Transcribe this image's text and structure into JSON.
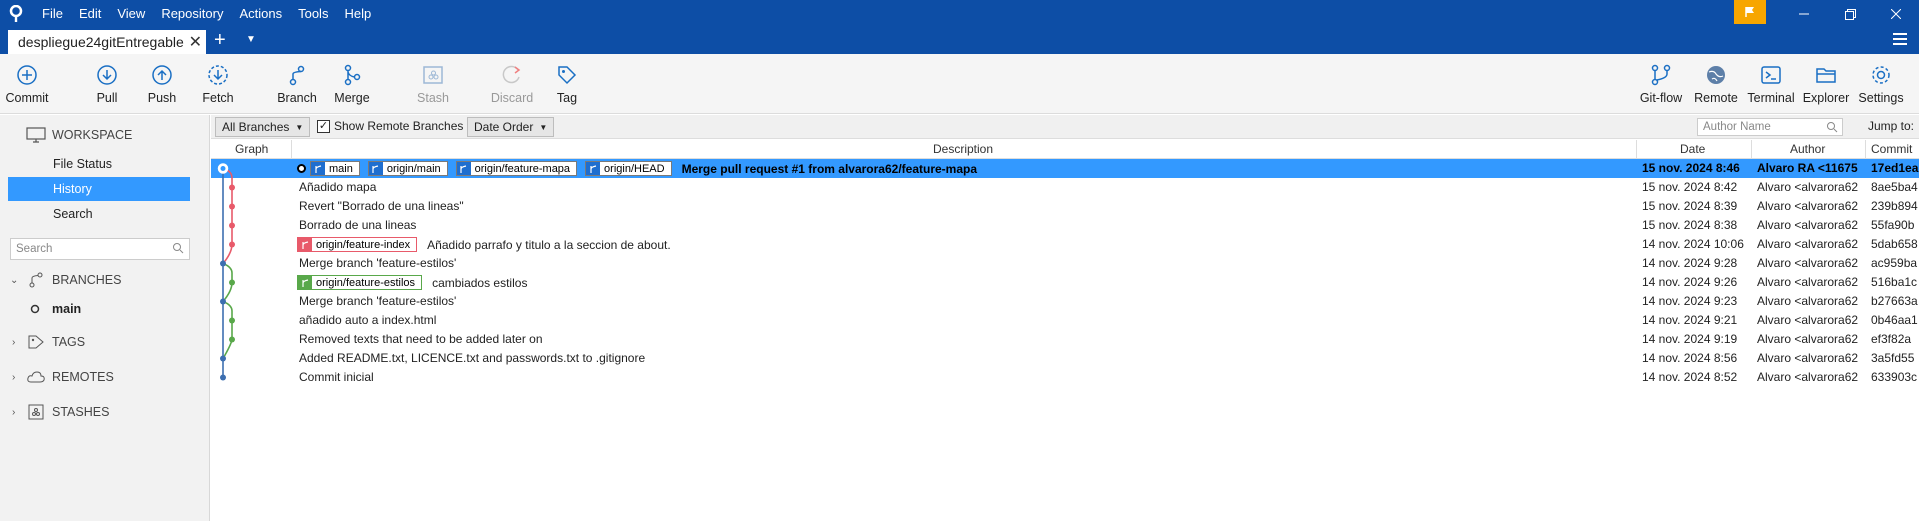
{
  "menu": {
    "items": [
      "File",
      "Edit",
      "View",
      "Repository",
      "Actions",
      "Tools",
      "Help"
    ]
  },
  "tab": {
    "title": "despliegue24gitEntregable"
  },
  "toolbar": {
    "left": [
      {
        "label": "Commit",
        "icon": "plus-circle-icon"
      },
      {
        "label": "Pull",
        "icon": "pull-icon"
      },
      {
        "label": "Push",
        "icon": "push-icon"
      },
      {
        "label": "Fetch",
        "icon": "fetch-icon"
      },
      {
        "label": "Branch",
        "icon": "branch-icon"
      },
      {
        "label": "Merge",
        "icon": "merge-icon"
      },
      {
        "label": "Stash",
        "icon": "stash-icon",
        "disabled": true
      },
      {
        "label": "Discard",
        "icon": "discard-icon",
        "disabled": true
      },
      {
        "label": "Tag",
        "icon": "tag-icon"
      }
    ],
    "right": [
      {
        "label": "Git-flow",
        "icon": "gitflow-icon"
      },
      {
        "label": "Remote",
        "icon": "globe-icon"
      },
      {
        "label": "Terminal",
        "icon": "terminal-icon"
      },
      {
        "label": "Explorer",
        "icon": "folder-icon"
      },
      {
        "label": "Settings",
        "icon": "gear-icon"
      }
    ]
  },
  "sidebar": {
    "workspace_label": "WORKSPACE",
    "workspace_items": [
      "File Status",
      "History",
      "Search"
    ],
    "selected_item": "History",
    "search_placeholder": "Search",
    "branches_label": "BRANCHES",
    "branches": [
      "main"
    ],
    "tags_label": "TAGS",
    "remotes_label": "REMOTES",
    "stashes_label": "STASHES"
  },
  "filters": {
    "branches_select": "All Branches",
    "show_remote_label": "Show Remote Branches",
    "show_remote_checked": true,
    "order_select": "Date Order",
    "author_placeholder": "Author Name",
    "jump_to": "Jump to:"
  },
  "columns": {
    "graph": "Graph",
    "description": "Description",
    "date": "Date",
    "author": "Author",
    "commit": "Commit"
  },
  "commits": [
    {
      "refs": [
        "main",
        "origin/main",
        "origin/feature-mapa",
        "origin/HEAD"
      ],
      "message": "Merge pull request #1 from alvarora62/feature-mapa",
      "date": "15 nov. 2024 8:46",
      "author": "Alvaro RA <11675",
      "hash": "17ed1ea"
    },
    {
      "refs": [],
      "message": "Añadido mapa",
      "date": "15 nov. 2024 8:42",
      "author": "Alvaro <alvarora62",
      "hash": "8ae5ba4"
    },
    {
      "refs": [],
      "message": "Revert \"Borrado de una lineas\"",
      "date": "15 nov. 2024 8:39",
      "author": "Alvaro <alvarora62",
      "hash": "239b894"
    },
    {
      "refs": [],
      "message": "Borrado de una lineas",
      "date": "15 nov. 2024 8:38",
      "author": "Alvaro <alvarora62",
      "hash": "55fa90b"
    },
    {
      "refs": [
        "origin/feature-index"
      ],
      "message": "Añadido parrafo y titulo a la seccion de about.",
      "date": "14 nov. 2024 10:06",
      "author": "Alvaro <alvarora62",
      "hash": "5dab658"
    },
    {
      "refs": [],
      "message": "Merge branch 'feature-estilos'",
      "date": "14 nov. 2024 9:28",
      "author": "Alvaro <alvarora62",
      "hash": "ac959ba"
    },
    {
      "refs": [
        "origin/feature-estilos"
      ],
      "message": "cambiados estilos",
      "date": "14 nov. 2024 9:26",
      "author": "Alvaro <alvarora62",
      "hash": "516ba1c"
    },
    {
      "refs": [],
      "message": "Merge branch 'feature-estilos'",
      "date": "14 nov. 2024 9:23",
      "author": "Alvaro <alvarora62",
      "hash": "b27663a"
    },
    {
      "refs": [],
      "message": "añadido auto a index.html",
      "date": "14 nov. 2024 9:21",
      "author": "Alvaro <alvarora62",
      "hash": "0b46aa1"
    },
    {
      "refs": [],
      "message": "Removed texts that need to be added later on",
      "date": "14 nov. 2024 9:19",
      "author": "Alvaro <alvarora62",
      "hash": "ef3f82a"
    },
    {
      "refs": [],
      "message": "Added README.txt, LICENCE.txt and passwords.txt to .gitignore",
      "date": "14 nov. 2024 8:56",
      "author": "Alvaro <alvarora62",
      "hash": "3a5fd55"
    },
    {
      "refs": [],
      "message": "Commit inicial",
      "date": "14 nov. 2024 8:52",
      "author": "Alvaro <alvarora62",
      "hash": "633903c"
    }
  ],
  "colors": {
    "titlebar": "#0d4ea6",
    "selection": "#3399ff",
    "branch_blue": "#3d6fb0",
    "branch_red": "#e85a6a",
    "branch_green": "#59a84a",
    "flag": "#f7a600"
  }
}
